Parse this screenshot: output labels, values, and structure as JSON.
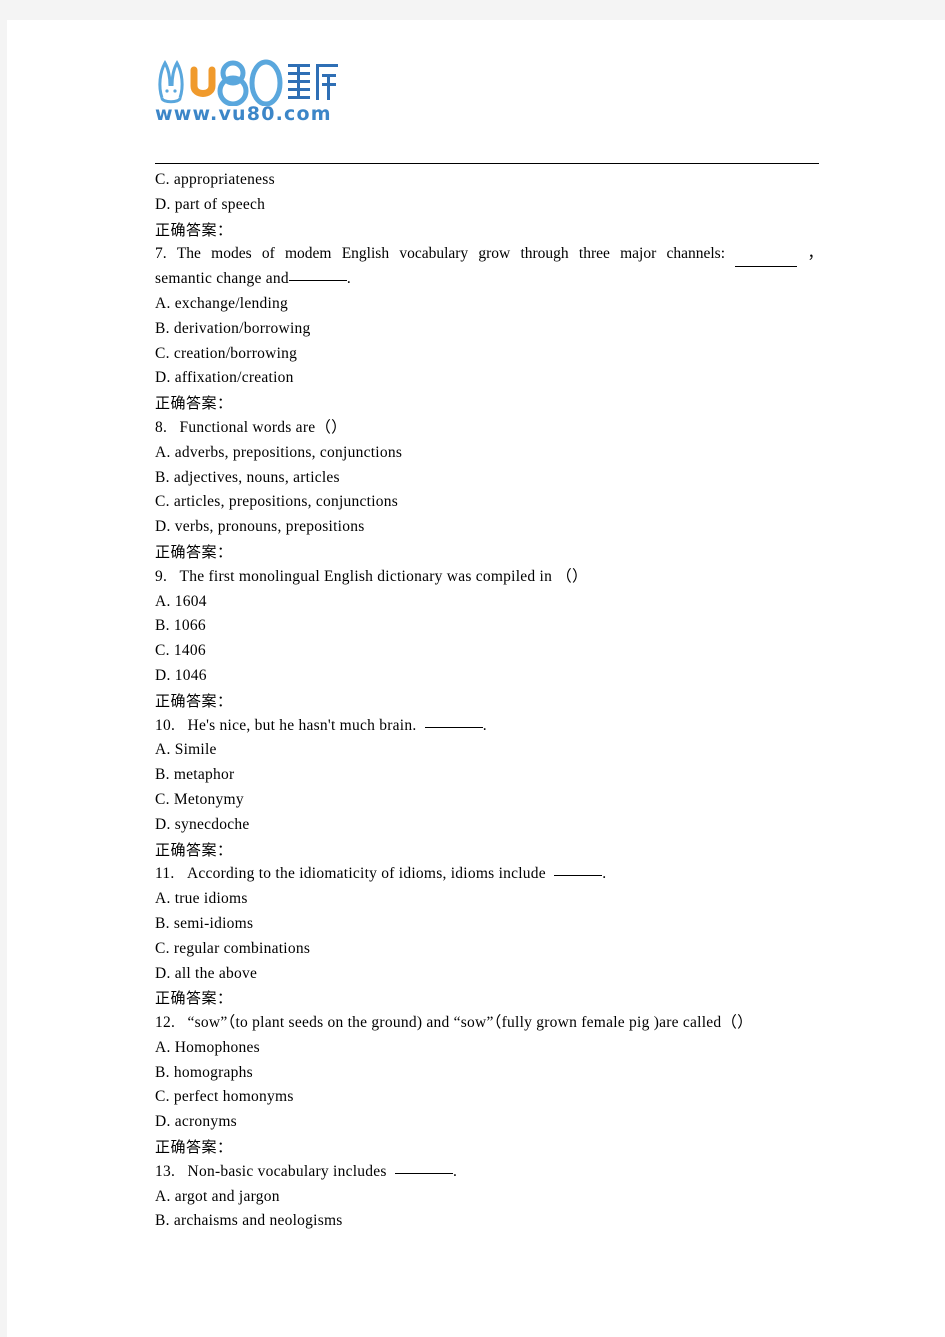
{
  "site": {
    "logo_text": "vu80题库网",
    "logo_url": "www.vu80.com",
    "logo_color_blue": "#3c86c8",
    "logo_color_orange": "#f09a2c"
  },
  "answer_label": "正确答案：",
  "carryover_options": [
    "C. appropriateness",
    "D. part of speech"
  ],
  "questions": [
    {
      "number": "7.",
      "stem_line1_words": [
        "The",
        "modes",
        "of",
        "modem",
        "English",
        "vocabulary",
        "grow",
        "through",
        "three",
        "major",
        "channels:"
      ],
      "stem_line1_tail": "，",
      "stem_line2": "semantic  change  and",
      "stem_line2_tail": ".",
      "options": [
        "A. exchange/lending",
        "B. derivation/borrowing",
        "C. creation/borrowing",
        "D. affixation/creation"
      ]
    },
    {
      "number": "8.",
      "stem": "Functional  words  are（）",
      "options": [
        "A. adverbs,  prepositions,  conjunctions",
        "B. adjectives,  nouns,  articles",
        "C. articles,  prepositions,  conjunctions",
        "D. verbs,  pronouns,  prepositions"
      ]
    },
    {
      "number": "9.",
      "stem": "The  first  monolingual  English  dictionary  was  compiled  in （）",
      "options": [
        "A. 1604",
        "B. 1066",
        "C. 1406",
        "D. 1046"
      ]
    },
    {
      "number": "10.",
      "stem": "He's  nice,  but  he  hasn't  much  brain.",
      "stem_tail": ".",
      "options": [
        "A. Simile",
        "B. metaphor",
        "C. Metonymy",
        "D. synecdoche"
      ]
    },
    {
      "number": "11.",
      "stem": "According  to  the  idiomaticity  of  idioms,  idioms  include",
      "stem_tail": ".",
      "options": [
        "A. true  idioms",
        "B. semi-idioms",
        "C. regular  combinations",
        "D. all  the  above"
      ]
    },
    {
      "number": "12.",
      "stem": "“sow”（to plant seeds on the ground) and  “sow”（fully grown female pig )are called（）",
      "options": [
        "A. Homophones",
        "B. homographs",
        "C. perfect  homonyms",
        "D. acronyms"
      ]
    },
    {
      "number": "13.",
      "stem": "Non-basic  vocabulary  includes",
      "stem_tail": ".",
      "options": [
        "A. argot  and  jargon",
        "B. archaisms  and  neologisms"
      ]
    }
  ]
}
